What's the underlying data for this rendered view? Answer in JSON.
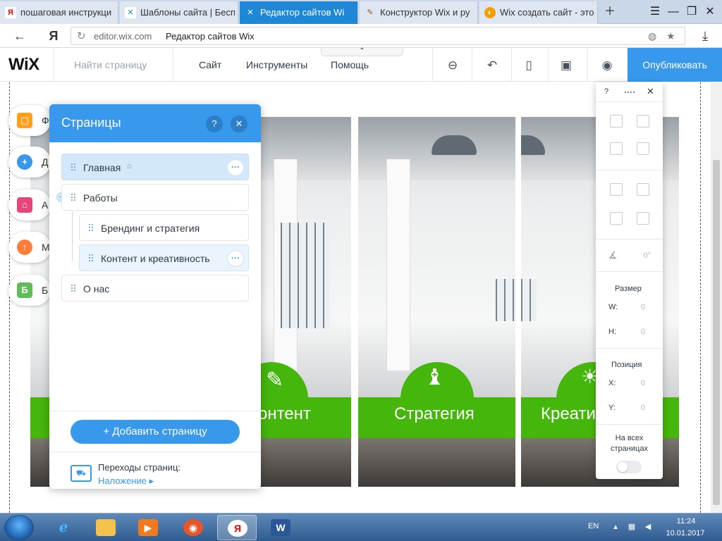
{
  "browser": {
    "tabs": [
      {
        "label": "пошаговая инструкци",
        "icon": "yandex-favicon",
        "active": false
      },
      {
        "label": "Шаблоны сайта | Бесп",
        "icon": "wix-favicon",
        "active": false
      },
      {
        "label": "Редактор сайтов Wi",
        "icon": "wix-favicon",
        "active": true
      },
      {
        "label": "Конструктор Wix и ру",
        "icon": "konstruktor-favicon",
        "active": false
      },
      {
        "label": "Wix создать сайт - это",
        "icon": "orange-favicon",
        "active": false
      }
    ],
    "url_host": "editor.wix.com",
    "page_title": "Редактор сайтов Wix",
    "logo_letter": "Я"
  },
  "wix": {
    "logo": "WiX",
    "find_page_placeholder": "Найти страницу",
    "menu": [
      "Сайт",
      "Инструменты",
      "Помощь"
    ],
    "publish": "Опубликовать"
  },
  "add_panel": {
    "items": [
      {
        "letter": "Ф",
        "icon": "square-icon",
        "color": "#ff9f1a"
      },
      {
        "letter": "Д",
        "icon": "plus-icon",
        "color": "#3899ec"
      },
      {
        "letter": "А",
        "icon": "store-icon",
        "color": "#e8457a"
      },
      {
        "letter": "М",
        "icon": "cloud-upload-icon",
        "color": "#ff7d38"
      },
      {
        "letter": "Б",
        "icon": "blog-icon",
        "color": "#60bc57"
      }
    ]
  },
  "pages_panel": {
    "title": "Страницы",
    "help": "?",
    "close": "✕",
    "items": [
      {
        "name": "Главная",
        "level": 0,
        "home": true
      },
      {
        "name": "Работы",
        "level": 0,
        "home": false
      },
      {
        "name": "Брендинг и стратегия",
        "level": 1,
        "home": false
      },
      {
        "name": "Контент и креативность",
        "level": 1,
        "home": false
      },
      {
        "name": "О нас",
        "level": 0,
        "home": false
      }
    ],
    "add_button": "+ Добавить страницу",
    "transitions_title": "Переходы страниц:",
    "transitions_value": "Наложение ▸"
  },
  "canvas": {
    "band_texts": [
      "онтент",
      "Стратегия",
      "Креативность"
    ],
    "accent_color": "#45b60c"
  },
  "tools_panel": {
    "help": "?",
    "close": "✕",
    "rotation": "0°",
    "size_label": "Размер",
    "w_label": "W:",
    "w_value": "0",
    "h_label": "H:",
    "h_value": "0",
    "position_label": "Позиция",
    "x_label": "X:",
    "x_value": "0",
    "y_label": "Y:",
    "y_value": "0",
    "all_pages_label": "На всех страницах"
  },
  "taskbar": {
    "lang": "EN",
    "time": "11:24",
    "date": "10.01.2017"
  }
}
